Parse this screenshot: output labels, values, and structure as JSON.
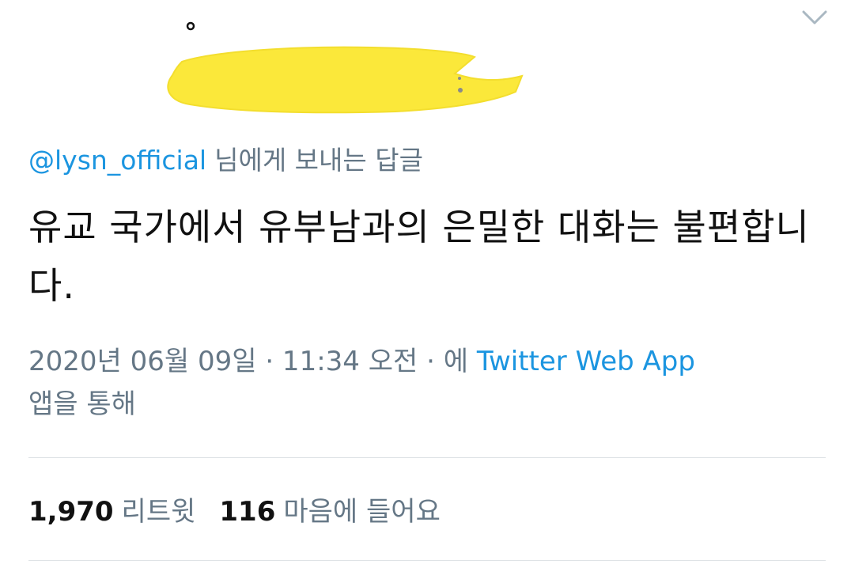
{
  "tweet": {
    "reply_handle": "@lysn_official",
    "reply_suffix": "님에게 보내는 답글",
    "text": "유교 국가에서 유부남과의 은밀한 대화는 불편합니다.",
    "timestamp": "2020년 06월 09일 · 11:34 오전 · 에",
    "source": "Twitter Web App",
    "source_suffix": "앱을 통해"
  },
  "stats": {
    "retweets_count": "1,970",
    "retweets_label": "리트윗",
    "likes_count": "116",
    "likes_label": "마음에 들어요"
  },
  "icons": {
    "menu": "chevron-down-icon"
  },
  "colors": {
    "link": "#1b95e0",
    "secondary_text": "#657786",
    "redaction": "#fbe83a",
    "divider": "#dfe3e6"
  }
}
